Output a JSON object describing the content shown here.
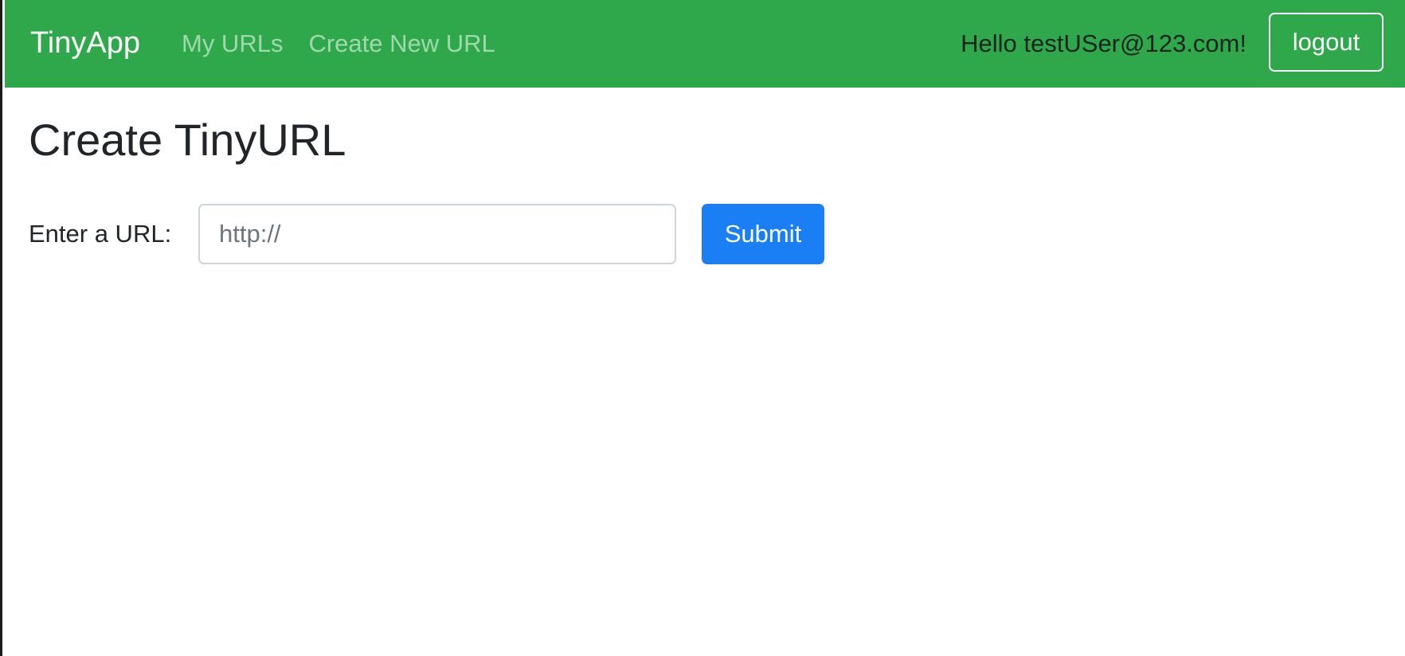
{
  "navbar": {
    "brand": "TinyApp",
    "links": [
      {
        "label": "My URLs"
      },
      {
        "label": "Create New URL"
      }
    ],
    "greeting": "Hello testUSer@123.com!",
    "logout_label": "logout",
    "background_color": "#2ea84a"
  },
  "main": {
    "title": "Create TinyURL",
    "form": {
      "label": "Enter a URL:",
      "input_value": "",
      "input_placeholder": "http://",
      "submit_label": "Submit",
      "submit_color": "#1a7ff5"
    }
  }
}
